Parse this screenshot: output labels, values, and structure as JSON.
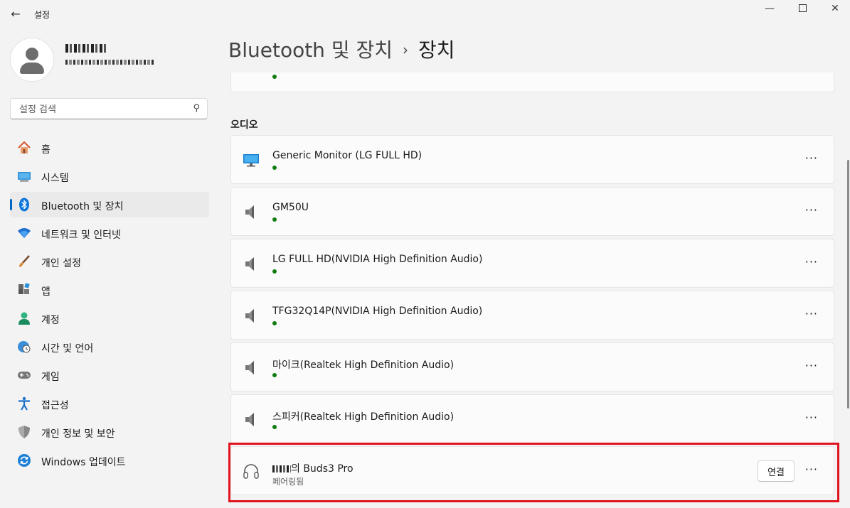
{
  "window": {
    "title": "설정"
  },
  "search": {
    "placeholder": "설정 검색"
  },
  "nav": {
    "items": [
      {
        "label": "홈"
      },
      {
        "label": "시스템"
      },
      {
        "label": "Bluetooth 및 장치"
      },
      {
        "label": "네트워크 및 인터넷"
      },
      {
        "label": "개인 설정"
      },
      {
        "label": "앱"
      },
      {
        "label": "계정"
      },
      {
        "label": "시간 및 언어"
      },
      {
        "label": "게임"
      },
      {
        "label": "접근성"
      },
      {
        "label": "개인 정보 및 보안"
      },
      {
        "label": "Windows 업데이트"
      }
    ],
    "active_index": 2
  },
  "header": {
    "parent": "Bluetooth 및 장치",
    "separator": "›",
    "current": "장치"
  },
  "section": {
    "title": "오디오"
  },
  "devices": [
    {
      "name": "Generic Monitor (LG FULL HD)",
      "icon": "monitor-icon",
      "status": "connected"
    },
    {
      "name": "GM50U",
      "icon": "speaker-icon",
      "status": "connected"
    },
    {
      "name": "LG FULL HD(NVIDIA High Definition Audio)",
      "icon": "speaker-icon",
      "status": "connected"
    },
    {
      "name": "TFG32Q14P(NVIDIA High Definition Audio)",
      "icon": "speaker-icon",
      "status": "connected"
    },
    {
      "name": "마이크(Realtek High Definition Audio)",
      "icon": "speaker-icon",
      "status": "connected"
    },
    {
      "name": "스피커(Realtek High Definition Audio)",
      "icon": "speaker-icon",
      "status": "connected"
    }
  ],
  "paired_device": {
    "name_suffix": "의 Buds3 Pro",
    "status_text": "페어링됨",
    "connect_label": "연결",
    "icon": "headphones-icon"
  },
  "more_label": "···",
  "colors": {
    "accent": "#0067c0",
    "connected_dot": "#107c10",
    "highlight": "#e0141e"
  }
}
